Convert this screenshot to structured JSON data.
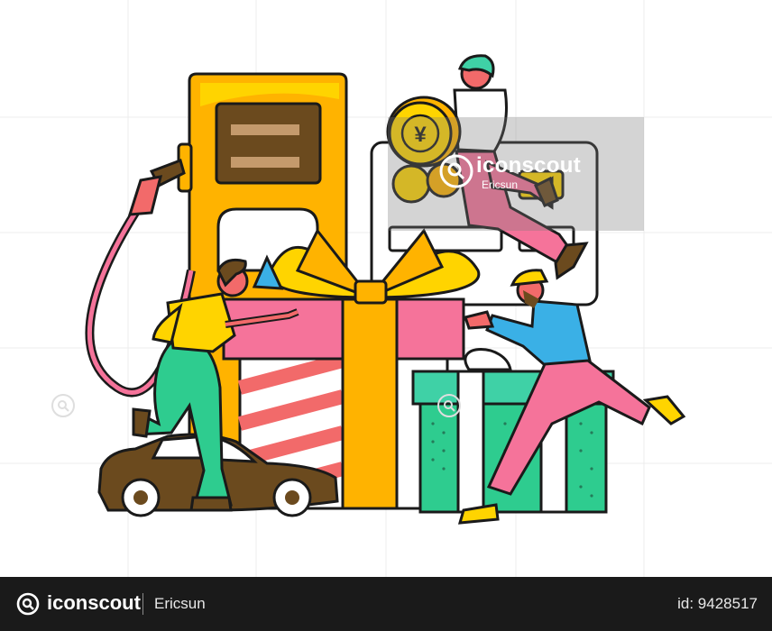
{
  "watermark": {
    "brand": "iconscout",
    "author": "Ericsun"
  },
  "footer": {
    "brand": "iconscout",
    "author": "Ericsun",
    "asset_id": "id: 9428517"
  },
  "colors": {
    "yellow": "#FFD400",
    "orange": "#FFB300",
    "pink": "#F5739A",
    "red_stripe": "#F26A6A",
    "green": "#2ECC8F",
    "teal": "#3FD1A6",
    "brown": "#6B4A1E",
    "blue": "#3AB0E6",
    "outline": "#1a1a1a"
  },
  "icons": [
    "fuel-pump-icon",
    "gift-box-icon",
    "car-icon",
    "yen-coin-icon",
    "credit-card-icon"
  ]
}
